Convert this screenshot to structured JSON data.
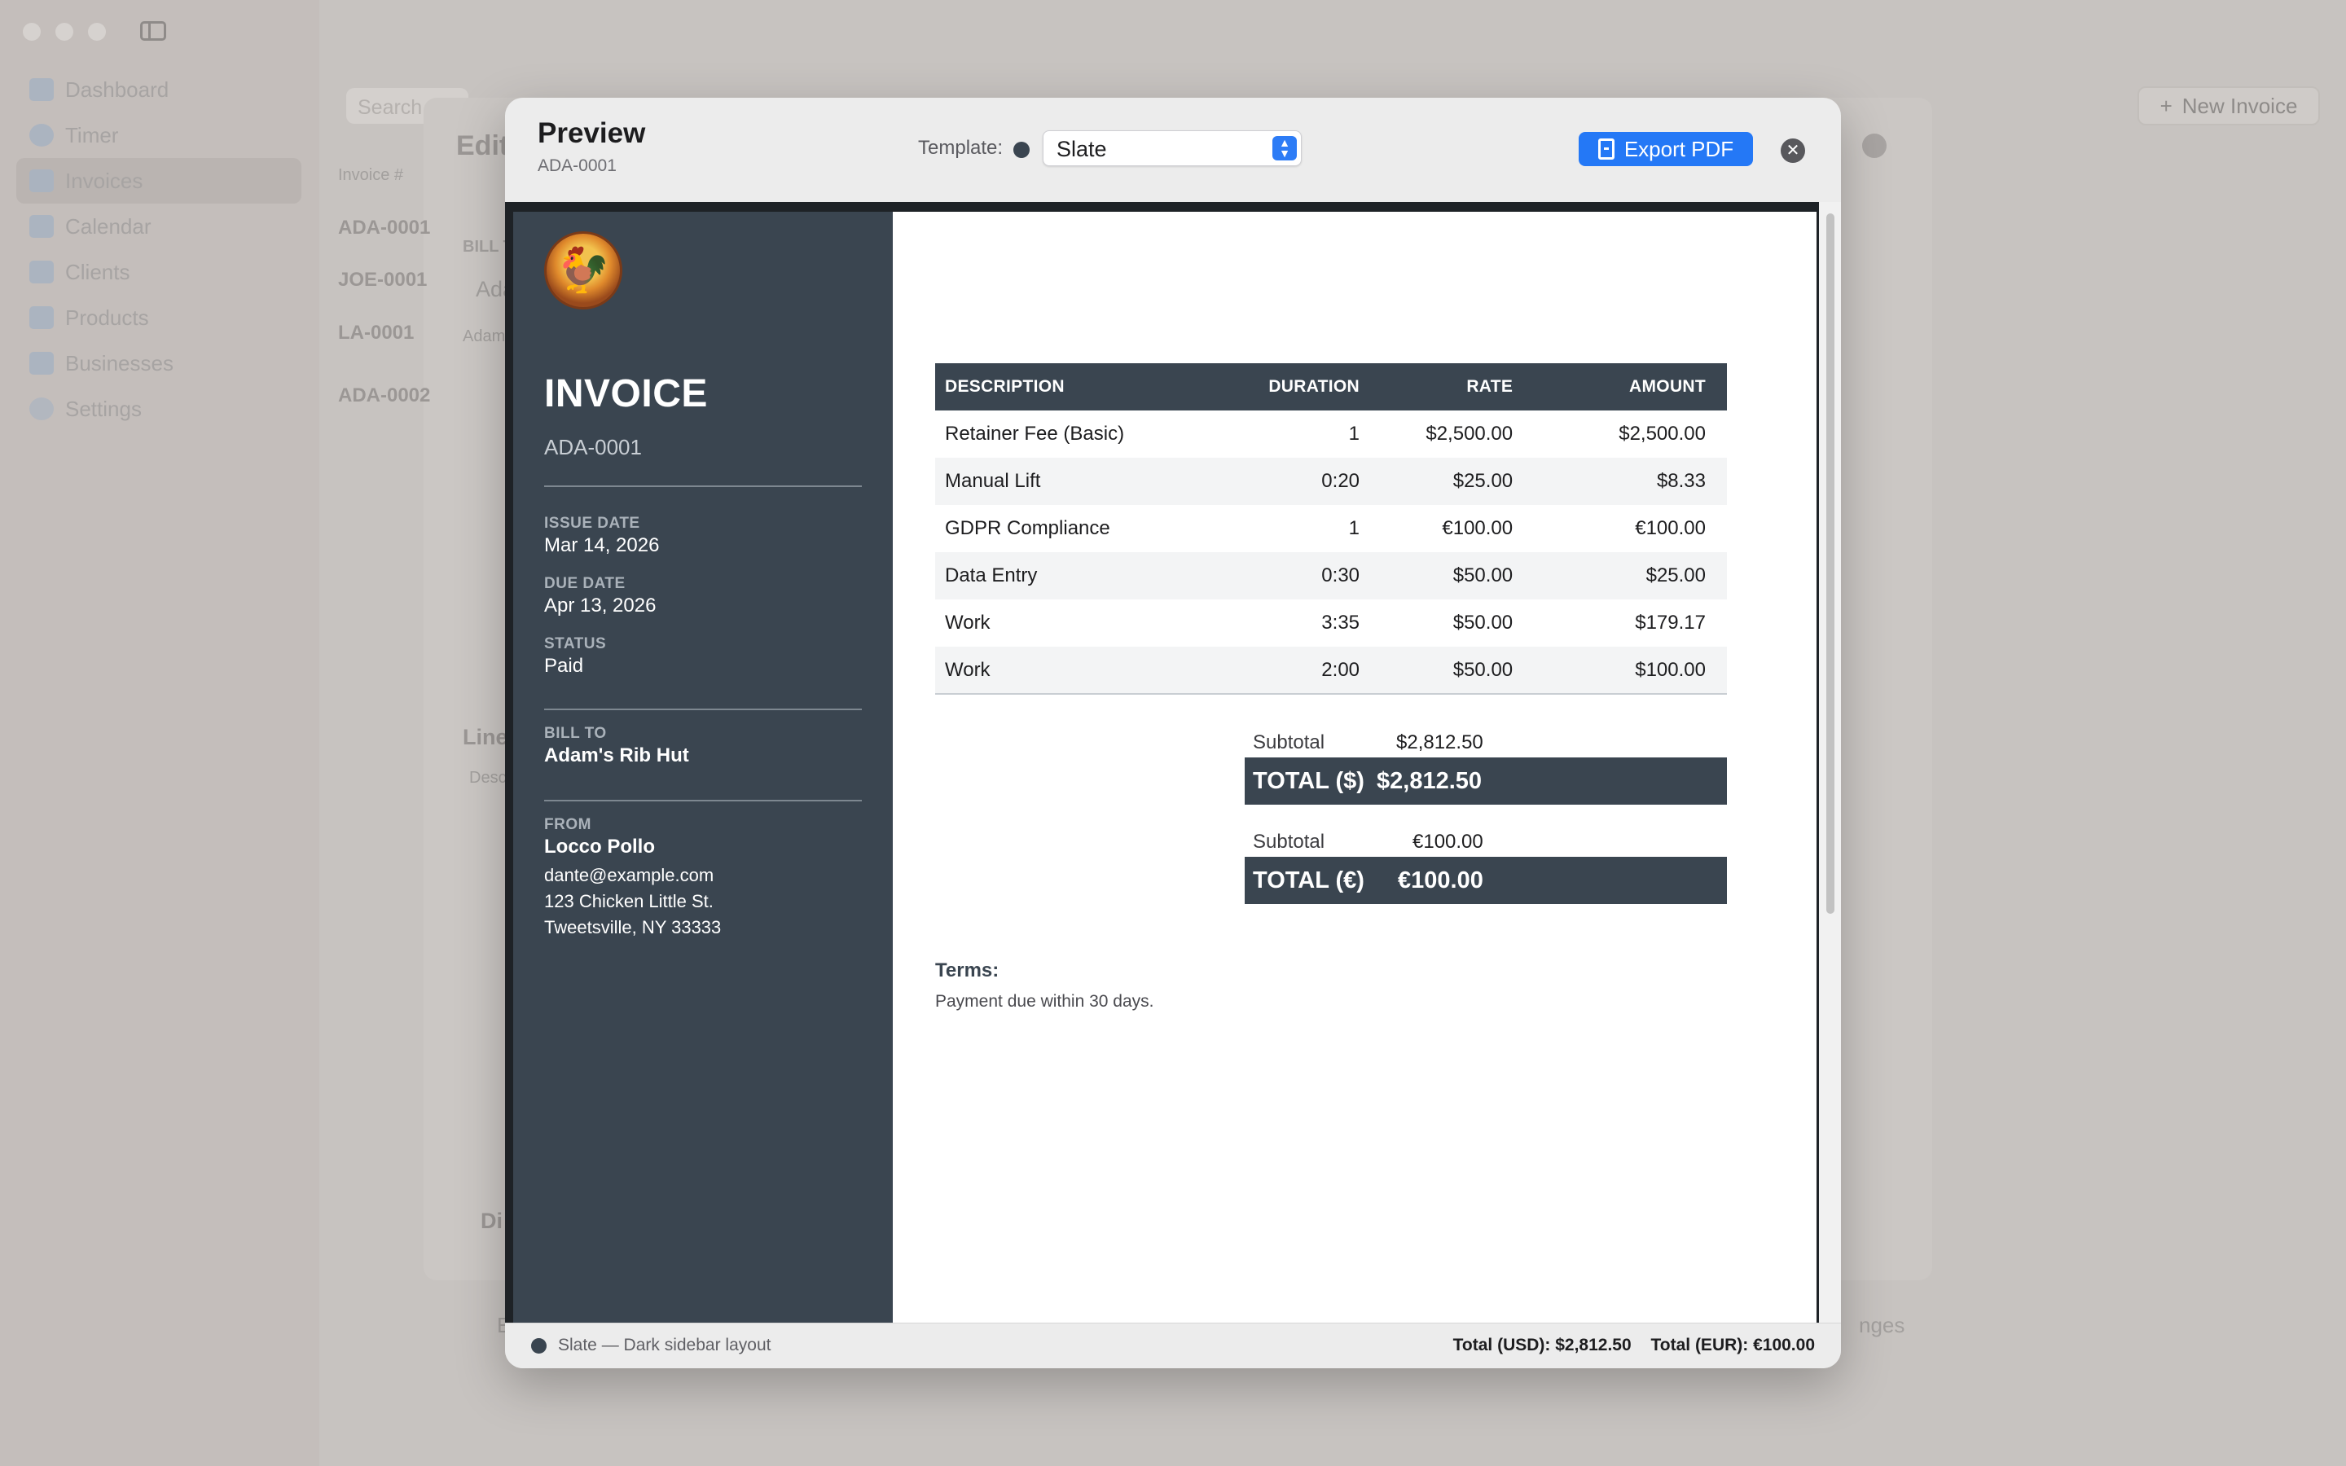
{
  "sidebar": {
    "items": [
      {
        "label": "Dashboard",
        "icon": "chart-icon"
      },
      {
        "label": "Timer",
        "icon": "clock-icon"
      },
      {
        "label": "Invoices",
        "icon": "document-icon"
      },
      {
        "label": "Calendar",
        "icon": "calendar-icon"
      },
      {
        "label": "Clients",
        "icon": "people-icon"
      },
      {
        "label": "Products",
        "icon": "cube-icon"
      },
      {
        "label": "Businesses",
        "icon": "building-icon"
      },
      {
        "label": "Settings",
        "icon": "gear-icon"
      }
    ]
  },
  "background": {
    "search_placeholder": "Search",
    "new_invoice_label": "New Invoice",
    "editor_title": "Edit",
    "invoice_column": "Invoice #",
    "invoices": [
      "ADA-0001",
      "JOE-0001",
      "LA-0001",
      "ADA-0002"
    ],
    "bill_to_label": "BILL T",
    "bill_to_value": "Ada",
    "bill_to_sub": "Adam",
    "line_items_label": "Line",
    "desc_label": "Desc",
    "discount_label": "Di",
    "bottom_right_label": "nges",
    "bottom_left_label": "E"
  },
  "preview": {
    "title": "Preview",
    "subtitle": "ADA-0001",
    "template_label": "Template:",
    "template_value": "Slate",
    "export_label": "Export PDF",
    "footer_label": "Slate — Dark sidebar layout",
    "footer_total_usd": "Total (USD): $2,812.50",
    "footer_total_eur": "Total (EUR): €100.00",
    "accent_color": "#2478f6",
    "template_color": "#3a4550"
  },
  "invoice": {
    "title": "INVOICE",
    "number": "ADA-0001",
    "issue_date_label": "ISSUE DATE",
    "issue_date": "Mar 14, 2026",
    "due_date_label": "DUE DATE",
    "due_date": "Apr 13, 2026",
    "status_label": "STATUS",
    "status": "Paid",
    "bill_to_label": "BILL TO",
    "bill_to": "Adam's Rib Hut",
    "from_label": "FROM",
    "from_name": "Locco Pollo",
    "from_email": "dante@example.com",
    "from_address1": "123 Chicken Little St.",
    "from_address2": "Tweetsville, NY 33333",
    "columns": [
      "DESCRIPTION",
      "DURATION",
      "RATE",
      "AMOUNT"
    ],
    "rows": [
      {
        "description": "Retainer Fee (Basic)",
        "duration": "1",
        "rate": "$2,500.00",
        "amount": "$2,500.00"
      },
      {
        "description": "Manual Lift",
        "duration": "0:20",
        "rate": "$25.00",
        "amount": "$8.33"
      },
      {
        "description": "GDPR Compliance",
        "duration": "1",
        "rate": "€100.00",
        "amount": "€100.00"
      },
      {
        "description": "Data Entry",
        "duration": "0:30",
        "rate": "$50.00",
        "amount": "$25.00"
      },
      {
        "description": "Work",
        "duration": "3:35",
        "rate": "$50.00",
        "amount": "$179.17"
      },
      {
        "description": "Work",
        "duration": "2:00",
        "rate": "$50.00",
        "amount": "$100.00"
      }
    ],
    "usd_subtotal_label": "Subtotal",
    "usd_subtotal": "$2,812.50",
    "usd_total_label": "TOTAL ($)",
    "usd_total": "$2,812.50",
    "eur_subtotal_label": "Subtotal",
    "eur_subtotal": "€100.00",
    "eur_total_label": "TOTAL (€)",
    "eur_total": "€100.00",
    "terms_label": "Terms:",
    "terms_text": "Payment due within 30 days."
  }
}
